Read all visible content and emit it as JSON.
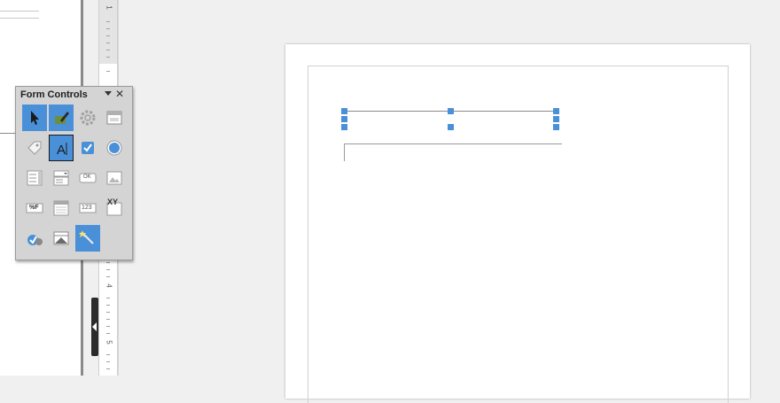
{
  "toolbar": {
    "title": "Form Controls",
    "buttons": [
      {
        "name": "select-button",
        "icon": "pointer-arrow-icon",
        "active": true
      },
      {
        "name": "design-mode-button",
        "icon": "design-mode-icon",
        "active": true
      },
      {
        "name": "control-properties-button",
        "icon": "gear-icon",
        "active": false
      },
      {
        "name": "form-properties-button",
        "icon": "form-dialog-icon",
        "active": false
      },
      {
        "name": "label-button",
        "icon": "label-tag-icon",
        "active": false
      },
      {
        "name": "text-box-button",
        "icon": "text-box-icon",
        "active": true,
        "outlined": true
      },
      {
        "name": "check-box-button",
        "icon": "checkbox-icon",
        "active": false
      },
      {
        "name": "option-button",
        "icon": "radio-button-icon",
        "active": false
      },
      {
        "name": "list-box-button",
        "icon": "list-box-icon",
        "active": false
      },
      {
        "name": "combo-box-button",
        "icon": "combo-box-icon",
        "active": false
      },
      {
        "name": "push-button-button",
        "icon": "push-button-icon",
        "active": false
      },
      {
        "name": "image-button-button",
        "icon": "image-button-icon",
        "active": false
      },
      {
        "name": "formatted-field-button",
        "icon": "formatted-field-icon",
        "active": false
      },
      {
        "name": "date-field-button",
        "icon": "date-field-icon",
        "active": false
      },
      {
        "name": "numeric-field-button",
        "icon": "numeric-field-icon",
        "active": false
      },
      {
        "name": "xy-chart-button",
        "icon": "xy-chart-icon",
        "active": false
      },
      {
        "name": "form-navigator-button",
        "icon": "form-navigator-icon",
        "active": false
      },
      {
        "name": "table-control-button",
        "icon": "table-control-icon",
        "active": false
      },
      {
        "name": "wizards-button",
        "icon": "magic-wand-icon",
        "active": true
      }
    ],
    "labels": {
      "push_button": "OK",
      "formatted": "%F",
      "numeric": "123",
      "xy": "XY"
    },
    "accent": "#4a90d9"
  },
  "ruler": {
    "labels": [
      "1",
      "4",
      "5"
    ]
  }
}
